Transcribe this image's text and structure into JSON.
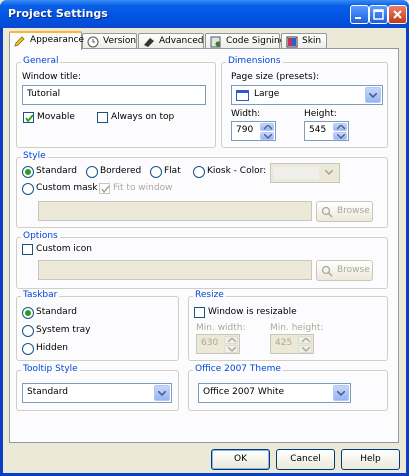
{
  "window": {
    "title": "Project Settings"
  },
  "tabs": [
    {
      "label": "Appearance"
    },
    {
      "label": "Version"
    },
    {
      "label": "Advanced"
    },
    {
      "label": "Code Signing"
    },
    {
      "label": "Skin"
    }
  ],
  "general": {
    "title": "General",
    "window_title_label": "Window title:",
    "window_title_value": "Tutorial",
    "movable": "Movable",
    "always_on_top": "Always on top"
  },
  "dimensions": {
    "title": "Dimensions",
    "page_size_label": "Page size (presets):",
    "page_size_value": "Large",
    "width_label": "Width:",
    "width_value": "790",
    "height_label": "Height:",
    "height_value": "545"
  },
  "style": {
    "title": "Style",
    "standard": "Standard",
    "bordered": "Bordered",
    "flat": "Flat",
    "kiosk": "Kiosk - Color:",
    "custom_mask": "Custom mask",
    "fit_to_window": "Fit to window",
    "browse": "Browse"
  },
  "options": {
    "title": "Options",
    "custom_icon": "Custom icon",
    "browse": "Browse"
  },
  "taskbar": {
    "title": "Taskbar",
    "standard": "Standard",
    "system_tray": "System tray",
    "hidden": "Hidden"
  },
  "resize": {
    "title": "Resize",
    "resizable": "Window is resizable",
    "min_width_label": "Min. width:",
    "min_width_value": "630",
    "min_height_label": "Min. height:",
    "min_height_value": "425"
  },
  "tooltip": {
    "title": "Tooltip Style",
    "value": "Standard"
  },
  "theme": {
    "title": "Office 2007 Theme",
    "value": "Office 2007 White"
  },
  "buttons": {
    "ok": "OK",
    "cancel": "Cancel",
    "help": "Help"
  },
  "colors": {
    "titlebar": "#0054e3",
    "group_title": "#0046d5",
    "background": "#ece9d8"
  }
}
